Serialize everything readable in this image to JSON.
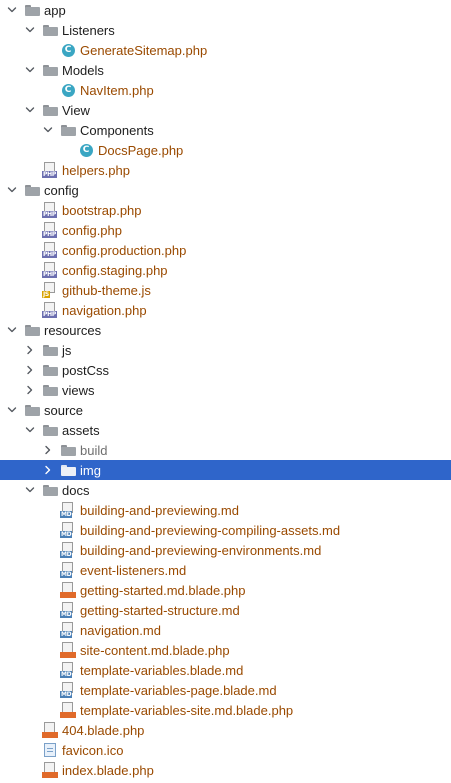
{
  "colors": {
    "selection": "#2f65ca",
    "file_label": "#9a4a00",
    "dir_label": "#1d1d1d",
    "excluded_label": "#6f6f6f"
  },
  "tree": [
    {
      "label": "app",
      "kind": "folder",
      "expanded": true,
      "depth": 0
    },
    {
      "label": "Listeners",
      "kind": "folder",
      "expanded": true,
      "depth": 1
    },
    {
      "label": "GenerateSitemap.php",
      "kind": "class",
      "depth": 2,
      "icon": "php-class-icon"
    },
    {
      "label": "Models",
      "kind": "folder",
      "expanded": true,
      "depth": 1
    },
    {
      "label": "NavItem.php",
      "kind": "class",
      "depth": 2,
      "icon": "php-class-icon"
    },
    {
      "label": "View",
      "kind": "folder",
      "expanded": true,
      "depth": 1
    },
    {
      "label": "Components",
      "kind": "folder",
      "expanded": true,
      "depth": 2
    },
    {
      "label": "DocsPage.php",
      "kind": "class",
      "depth": 3,
      "icon": "php-class-icon"
    },
    {
      "label": "helpers.php",
      "kind": "php",
      "depth": 1,
      "icon": "php-file-icon"
    },
    {
      "label": "config",
      "kind": "folder",
      "expanded": true,
      "depth": 0
    },
    {
      "label": "bootstrap.php",
      "kind": "php",
      "depth": 1,
      "icon": "php-file-icon"
    },
    {
      "label": "config.php",
      "kind": "php",
      "depth": 1,
      "icon": "php-file-icon"
    },
    {
      "label": "config.production.php",
      "kind": "php",
      "depth": 1,
      "icon": "php-file-icon"
    },
    {
      "label": "config.staging.php",
      "kind": "php",
      "depth": 1,
      "icon": "php-file-icon"
    },
    {
      "label": "github-theme.js",
      "kind": "js",
      "depth": 1,
      "icon": "js-file-icon"
    },
    {
      "label": "navigation.php",
      "kind": "php",
      "depth": 1,
      "icon": "php-file-icon"
    },
    {
      "label": "resources",
      "kind": "folder",
      "expanded": true,
      "depth": 0
    },
    {
      "label": "js",
      "kind": "folder",
      "expanded": false,
      "depth": 1
    },
    {
      "label": "postCss",
      "kind": "folder",
      "expanded": false,
      "depth": 1
    },
    {
      "label": "views",
      "kind": "folder",
      "expanded": false,
      "depth": 1
    },
    {
      "label": "source",
      "kind": "folder",
      "expanded": true,
      "depth": 0
    },
    {
      "label": "assets",
      "kind": "folder",
      "expanded": true,
      "depth": 1
    },
    {
      "label": "build",
      "kind": "folder",
      "expanded": false,
      "depth": 2,
      "excluded": true
    },
    {
      "label": "img",
      "kind": "folder",
      "expanded": false,
      "depth": 2,
      "selected": true
    },
    {
      "label": "docs",
      "kind": "folder",
      "expanded": true,
      "depth": 1
    },
    {
      "label": "building-and-previewing.md",
      "kind": "md",
      "depth": 2,
      "icon": "markdown-file-icon"
    },
    {
      "label": "building-and-previewing-compiling-assets.md",
      "kind": "md",
      "depth": 2,
      "icon": "markdown-file-icon"
    },
    {
      "label": "building-and-previewing-environments.md",
      "kind": "md",
      "depth": 2,
      "icon": "markdown-file-icon"
    },
    {
      "label": "event-listeners.md",
      "kind": "md",
      "depth": 2,
      "icon": "markdown-file-icon"
    },
    {
      "label": "getting-started.md.blade.php",
      "kind": "blade",
      "depth": 2,
      "icon": "blade-file-icon"
    },
    {
      "label": "getting-started-structure.md",
      "kind": "md",
      "depth": 2,
      "icon": "markdown-file-icon"
    },
    {
      "label": "navigation.md",
      "kind": "md",
      "depth": 2,
      "icon": "markdown-file-icon"
    },
    {
      "label": "site-content.md.blade.php",
      "kind": "blade",
      "depth": 2,
      "icon": "blade-file-icon"
    },
    {
      "label": "template-variables.blade.md",
      "kind": "md",
      "depth": 2,
      "icon": "markdown-file-icon"
    },
    {
      "label": "template-variables-page.blade.md",
      "kind": "md",
      "depth": 2,
      "icon": "markdown-file-icon"
    },
    {
      "label": "template-variables-site.md.blade.php",
      "kind": "blade",
      "depth": 2,
      "icon": "blade-file-icon"
    },
    {
      "label": "404.blade.php",
      "kind": "blade",
      "depth": 1,
      "icon": "blade-file-icon"
    },
    {
      "label": "favicon.ico",
      "kind": "ico",
      "depth": 1,
      "icon": "image-file-icon"
    },
    {
      "label": "index.blade.php",
      "kind": "blade",
      "depth": 1,
      "icon": "blade-file-icon"
    }
  ]
}
